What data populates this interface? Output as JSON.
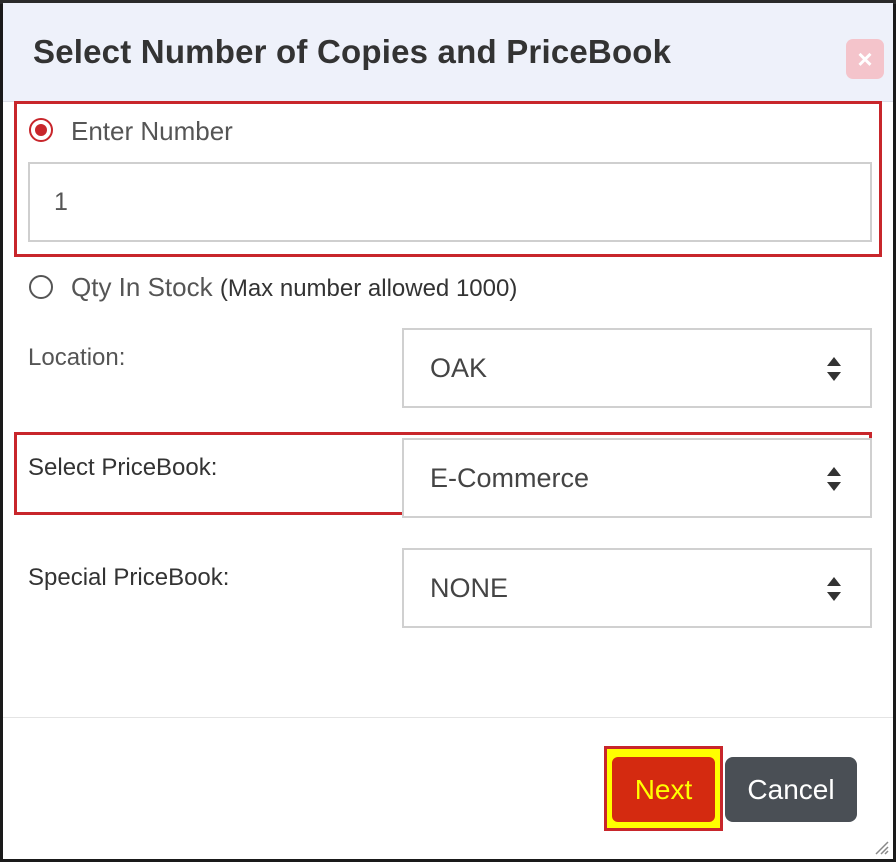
{
  "dialog": {
    "title": "Select Number of Copies and PriceBook",
    "close_label": "×"
  },
  "copies": {
    "option_enter_number": "Enter Number",
    "number_value": "1",
    "option_qty_in_stock": "Qty In Stock",
    "qty_note": "(Max number allowed 1000)",
    "selected_option": "Enter Number"
  },
  "fields": {
    "location_label": "Location:",
    "location_value": "OAK",
    "pricebook_label": "Select PriceBook:",
    "pricebook_value": "E-Commerce",
    "special_label": "Special PriceBook:",
    "special_value": "NONE"
  },
  "footer": {
    "next_label": "Next",
    "cancel_label": "Cancel"
  },
  "colors": {
    "highlight_border": "#c8262b",
    "next_bg": "#d42a10",
    "next_text": "#ffff00",
    "cancel_bg": "#4a4f55",
    "header_bg": "#eef1fa"
  },
  "icons": {
    "close": "close-icon",
    "select_arrows": "sort-arrows-icon",
    "resize": "resize-grip-icon"
  }
}
